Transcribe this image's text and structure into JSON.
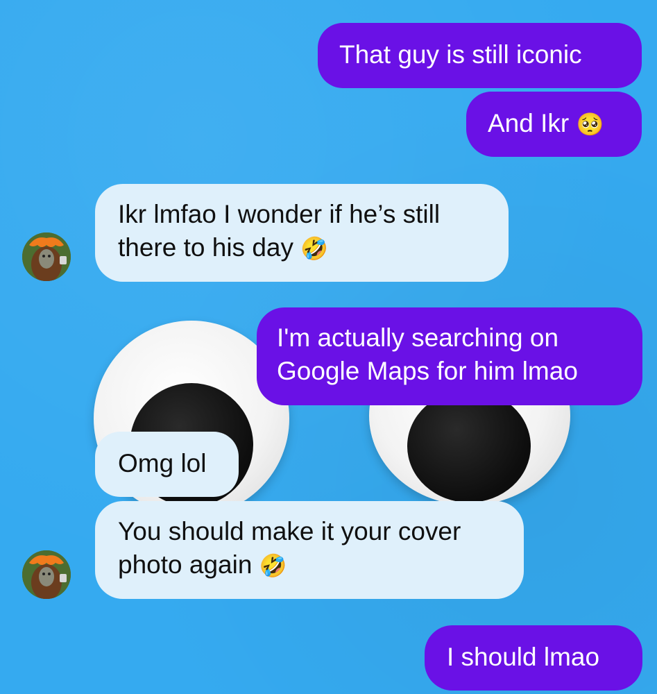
{
  "theme": {
    "background": "#35aaf0",
    "sent_bubble": "#6a11e6",
    "received_bubble": "#dff0fb"
  },
  "conversation": {
    "messages": [
      {
        "direction": "sent",
        "text": "That guy is still iconic"
      },
      {
        "direction": "sent",
        "text": "And Ikr",
        "emoji": "🥺",
        "emoji_name": "pleading-face-icon"
      },
      {
        "direction": "received",
        "line1": "Ikr lmfao I wonder if he’s still",
        "line2": "there to his day",
        "emoji": "🤣",
        "emoji_name": "rolling-laughing-icon",
        "avatar": "contact-avatar"
      },
      {
        "direction": "sent",
        "line1": "I'm actually searching on",
        "line2": "Google Maps for him lmao"
      },
      {
        "direction": "received",
        "text": "Omg lol"
      },
      {
        "direction": "received",
        "line1": "You should make it your cover",
        "line2": "photo again",
        "emoji": "🤣",
        "emoji_name": "rolling-laughing-icon",
        "avatar": "contact-avatar"
      },
      {
        "direction": "sent",
        "text": "I should lmao"
      }
    ]
  },
  "wallpaper": {
    "decoration": "googly-eyes"
  }
}
